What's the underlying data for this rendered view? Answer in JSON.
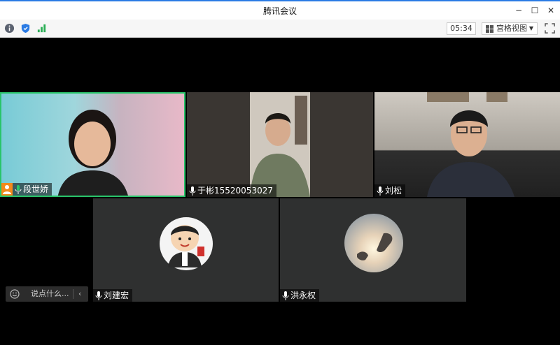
{
  "window": {
    "title": "腾讯会议"
  },
  "window_controls": {
    "minimize": "−",
    "maximize": "☐",
    "close": "✕"
  },
  "toolbar": {
    "timer": "05:34",
    "view_label": "宫格视图",
    "view_caret": "▼"
  },
  "participants": [
    {
      "name": "段世娇",
      "speaking": true
    },
    {
      "name": "于彬15520053027"
    },
    {
      "name": "刘松"
    },
    {
      "name": "刘建宏"
    },
    {
      "name": "洪永权"
    }
  ],
  "chat": {
    "placeholder": "说点什么...",
    "collapse": "‹"
  },
  "colors": {
    "accent": "#2b7be4",
    "speaking_border": "#29c46a",
    "tile_bg": "#2f3030"
  }
}
